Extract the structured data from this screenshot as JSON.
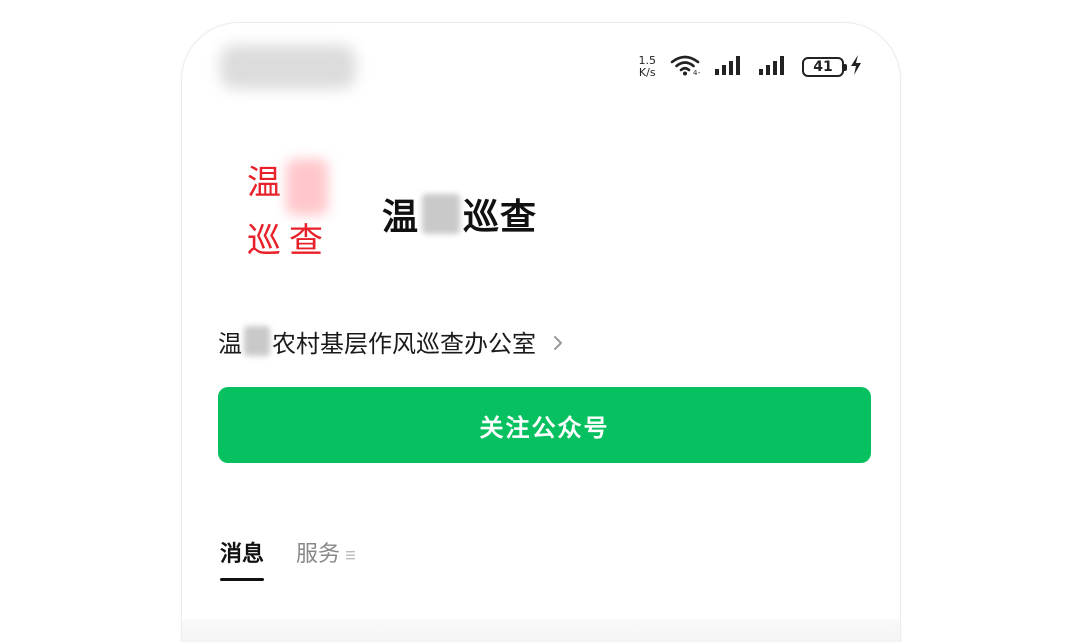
{
  "status_bar": {
    "net_speed_value": "1.5",
    "net_speed_unit": "K/s",
    "battery_level": "41"
  },
  "profile": {
    "logo_chars": [
      "温",
      "巡",
      "查"
    ],
    "name_prefix": "温",
    "name_suffix": "巡查",
    "owner_prefix": "温",
    "owner_suffix": "农村基层作风巡查办公室"
  },
  "follow_button": {
    "label": "关注公众号"
  },
  "tabs": [
    {
      "label": "消息",
      "active": true
    },
    {
      "label": "服务",
      "active": false
    }
  ],
  "colors": {
    "accent_green": "#07c160",
    "logo_red": "#e8202a"
  }
}
